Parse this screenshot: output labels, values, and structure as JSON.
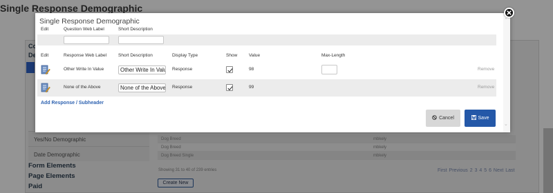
{
  "page": {
    "title": "Single Response Demographic",
    "sidebar": {
      "top_fragments": [
        "Co",
        "De"
      ],
      "items": [
        "Yes/No Demographic",
        "Date Demographic"
      ],
      "sections": [
        "Form Elements",
        "Page Elements",
        "Paid"
      ]
    },
    "table": {
      "rows": [
        {
          "name": "Dog Breed",
          "value": "mbkely"
        },
        {
          "name": "Dog Breed",
          "value": "mbkely"
        },
        {
          "name": "Dog Breed Single",
          "value": "mbkely"
        }
      ],
      "footer": "Showing 31 to 40 of 239 entries",
      "pager": "First Previous 2 3 4 5 6 Next Last",
      "create_label": "Create New"
    }
  },
  "modal": {
    "title": "Single Response Demographic",
    "top_headers": {
      "edit": "Edit",
      "web_label": "Question Web Label",
      "short_desc": "Short Description"
    },
    "response_headers": {
      "edit": "Edit",
      "web_label": "Response Web Label",
      "short_desc": "Short Description",
      "display_type": "Display Type",
      "show": "Show",
      "value": "Value",
      "max_length": "Max-Length"
    },
    "rows": [
      {
        "web_label": "Other Write In Value",
        "short_desc": "Other Write In Value",
        "display_type": "Response",
        "show": true,
        "value": "98",
        "max_length": "",
        "remove": "Remove"
      },
      {
        "web_label": "None of the Above",
        "short_desc": "None of the Above",
        "display_type": "Response",
        "show": true,
        "value": "99",
        "remove": "Remove"
      }
    ],
    "add_link": "Add Response / Subheader",
    "cancel_label": "Cancel",
    "save_label": "Save"
  },
  "icons": {
    "edit": "edit-document-icon",
    "cancel": "ban-icon",
    "save": "floppy-disk-icon",
    "close": "close-icon",
    "check": "check-icon"
  },
  "colors": {
    "primary": "#2458a8",
    "link": "#2f63b1",
    "overlay": "rgba(0,0,0,0.42)"
  }
}
